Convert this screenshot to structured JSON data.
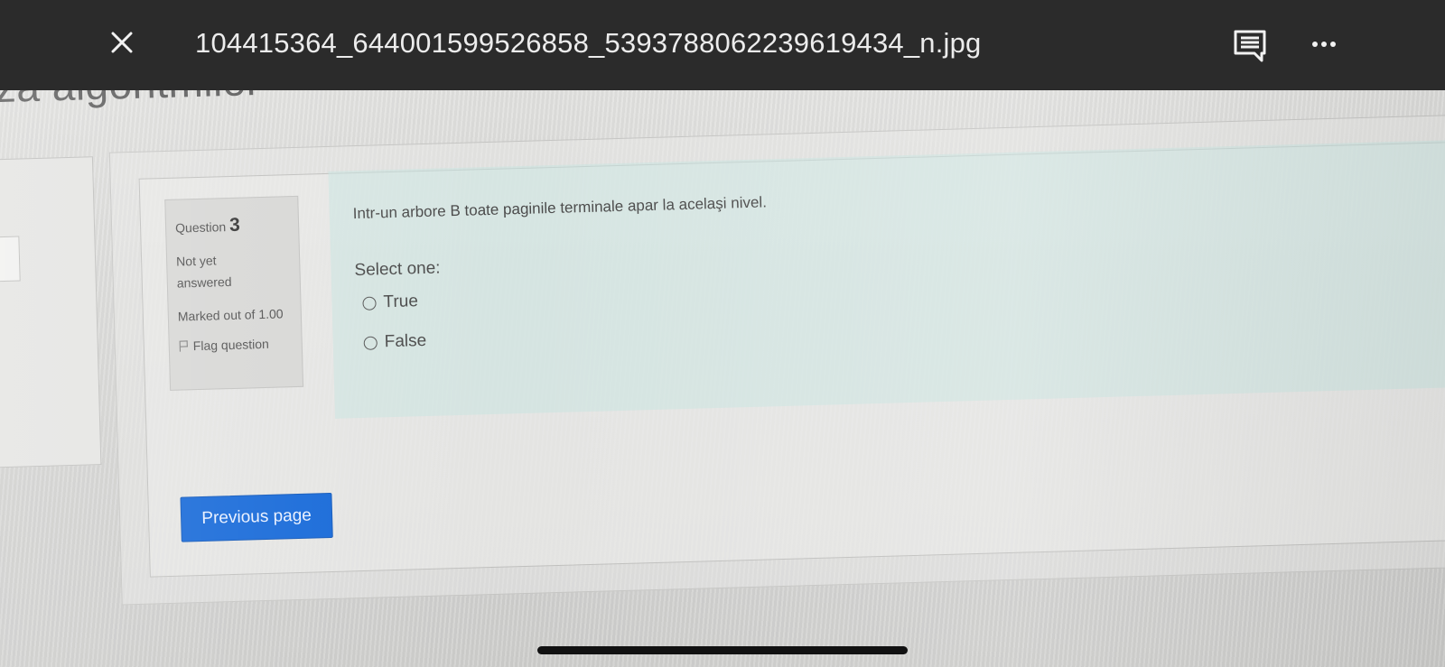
{
  "viewer": {
    "filename": "104415364_644001599526858_5393788062239619434_n.jpg",
    "close_icon": "close-icon",
    "comment_icon": "comment-icon",
    "more_icon": "more-horizontal-icon"
  },
  "page": {
    "heading_fragment": "za algoritmilor"
  },
  "question": {
    "label": "Question",
    "number": "3",
    "state": "Not yet answered",
    "marks": "Marked out of 1.00",
    "flag_label": "Flag question",
    "text": "Intr-un arbore B toate paginile terminale apar la acelaşi nivel.",
    "prompt": "Select one:",
    "options": [
      {
        "label": "True",
        "selected": false
      },
      {
        "label": "False",
        "selected": false
      }
    ]
  },
  "navigation": {
    "previous_label": "Previous page"
  },
  "colors": {
    "topbar": "#2b2b2b",
    "question_panel": "#c8e4e0",
    "primary_button": "#1367d8"
  }
}
